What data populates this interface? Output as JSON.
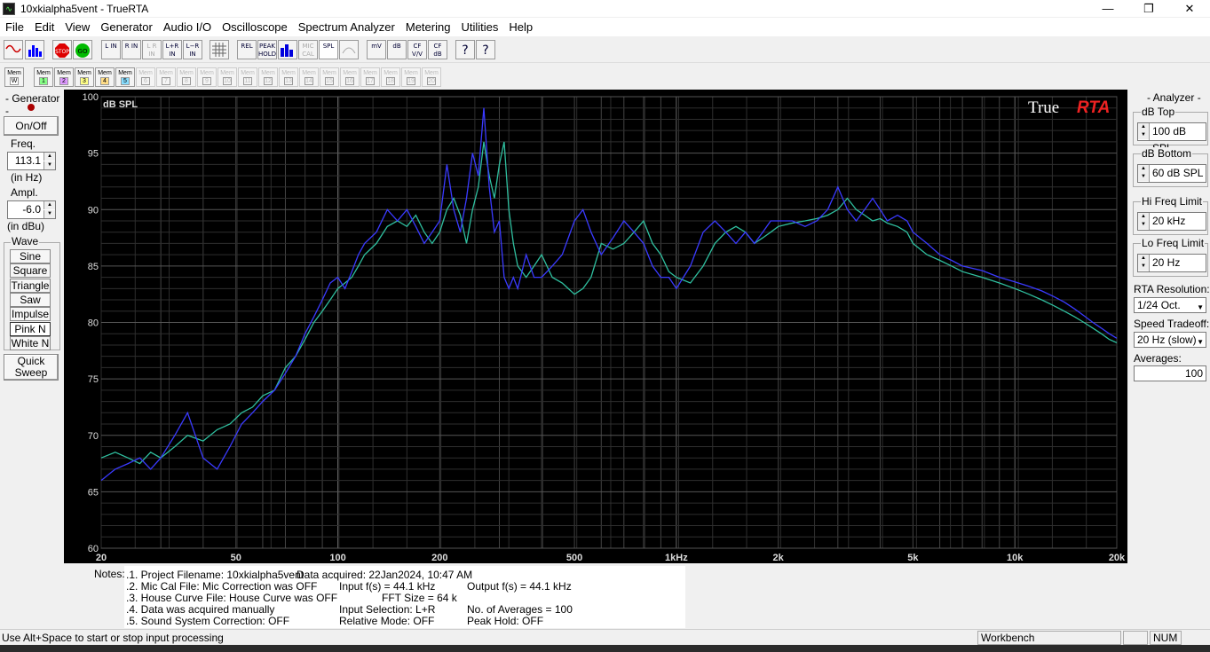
{
  "window": {
    "title": "10xkialpha5vent - TrueRTA",
    "minimize": "—",
    "maximize": "❐",
    "close": "✕"
  },
  "menu": [
    "File",
    "Edit",
    "View",
    "Generator",
    "Audio I/O",
    "Oscilloscope",
    "Spectrum Analyzer",
    "Metering",
    "Utilities",
    "Help"
  ],
  "toolbar": [
    "L IN",
    "R IN",
    "L R IN",
    "L+R IN",
    "L−R IN",
    "REL",
    "PEAK HOLD",
    "MIC CAL",
    "SPL",
    "mV",
    "dB",
    "CF V/V",
    "CF dB",
    "?",
    "?"
  ],
  "memories": {
    "prefix": "Mem",
    "labels": [
      "W",
      "1",
      "2",
      "3",
      "4",
      "5",
      "6",
      "7",
      "8",
      "9",
      "10",
      "11",
      "12",
      "13",
      "14",
      "15",
      "16",
      "17",
      "18",
      "19",
      "20"
    ]
  },
  "generator": {
    "title": "- Generator -",
    "onoff": "On/Off",
    "freq_title": "Freq.",
    "freq_value": "113.1",
    "freq_unit": "(in Hz)",
    "ampl_title": "Ampl.",
    "ampl_value": "-6.0",
    "ampl_unit": "(in dBu)",
    "wave_title": "Wave",
    "waves": [
      "Sine",
      "Square",
      "Triangle",
      "Saw",
      "Impulse",
      "Pink N",
      "White N"
    ],
    "quick_sweep": "Quick Sweep"
  },
  "analyzer": {
    "title": "- Analyzer -",
    "db_top_label": "dB Top",
    "db_top": "100 dB SPL",
    "db_bottom_label": "dB Bottom",
    "db_bottom": "60 dB SPL",
    "hi_label": "Hi Freq Limit",
    "hi": "20 kHz",
    "lo_label": "Lo Freq Limit",
    "lo": "20 Hz",
    "res_label": "RTA Resolution:",
    "res": "1/24 Oct.",
    "speed_label": "Speed Tradeoff:",
    "speed": "20 Hz (slow)",
    "avg_label": "Averages:",
    "avg": "100"
  },
  "chart_data": {
    "type": "line",
    "ylabel": "dB SPL",
    "brand_a": "True",
    "brand_b": "RTA",
    "ylim": [
      60,
      100
    ],
    "xlim": [
      20,
      20000
    ],
    "x_scale": "log",
    "yticks": [
      60,
      65,
      70,
      75,
      80,
      85,
      90,
      95,
      100
    ],
    "xtick_labels": [
      {
        "v": 20,
        "t": "20"
      },
      {
        "v": 50,
        "t": "50"
      },
      {
        "v": 100,
        "t": "100"
      },
      {
        "v": 200,
        "t": "200"
      },
      {
        "v": 500,
        "t": "500"
      },
      {
        "v": 1000,
        "t": "1kHz"
      },
      {
        "v": 2000,
        "t": "2k"
      },
      {
        "v": 5000,
        "t": "5k"
      },
      {
        "v": 10000,
        "t": "10k"
      },
      {
        "v": 20000,
        "t": "20k"
      }
    ],
    "grid": true,
    "colors": {
      "bg": "#000000",
      "grid": "#3a3a3a",
      "blue": "#3a3aff",
      "cyan": "#2fbf9f"
    },
    "series": [
      {
        "color": "#2fbf9f",
        "x": [
          20,
          22,
          24,
          26,
          28,
          30,
          33,
          36,
          40,
          44,
          48,
          52,
          56,
          60,
          65,
          70,
          75,
          80,
          85,
          90,
          95,
          100,
          105,
          110,
          115,
          120,
          130,
          140,
          150,
          160,
          170,
          180,
          190,
          200,
          210,
          220,
          230,
          240,
          250,
          260,
          270,
          280,
          290,
          300,
          310,
          320,
          330,
          340,
          360,
          380,
          400,
          430,
          460,
          500,
          530,
          560,
          600,
          650,
          700,
          750,
          800,
          850,
          900,
          950,
          1000,
          1100,
          1200,
          1300,
          1400,
          1500,
          1600,
          1700,
          1800,
          1900,
          2000,
          2200,
          2400,
          2600,
          2800,
          3000,
          3200,
          3400,
          3600,
          3800,
          4000,
          4200,
          4500,
          4800,
          5000,
          5500,
          6000,
          6500,
          7000,
          8000,
          9000,
          10000,
          11000,
          12000,
          13000,
          14000,
          15000,
          16000,
          17000,
          18000,
          19000,
          20000
        ],
        "y": [
          68,
          68.5,
          68,
          67.5,
          68.5,
          68,
          69,
          70,
          69.5,
          70.5,
          71,
          72,
          72.5,
          73.5,
          74,
          76,
          77,
          78.5,
          80,
          81,
          82,
          83,
          83.5,
          84,
          85,
          86,
          87,
          88.5,
          89,
          88.5,
          89.5,
          88,
          87,
          88,
          90,
          91,
          89.5,
          87,
          90,
          92,
          96,
          93,
          91,
          94,
          96,
          90,
          87,
          85,
          84,
          85,
          86,
          84,
          83.5,
          82.5,
          83,
          84,
          87,
          86.5,
          87,
          88,
          89,
          87,
          86,
          84.5,
          84,
          83.5,
          85,
          87,
          88,
          88.5,
          88,
          87,
          87.5,
          88,
          88.5,
          88.8,
          89,
          89.2,
          89.5,
          90,
          91,
          90,
          89.5,
          89,
          89.2,
          88.8,
          88.5,
          88,
          87,
          86,
          85.5,
          85,
          84.5,
          84,
          83.5,
          83,
          82.5,
          82,
          81.5,
          81,
          80.5,
          80,
          79.5,
          79,
          78.5,
          78.2
        ]
      },
      {
        "color": "#3a3aff",
        "x": [
          20,
          22,
          24,
          26,
          28,
          30,
          33,
          36,
          40,
          44,
          48,
          52,
          56,
          60,
          65,
          70,
          75,
          80,
          85,
          90,
          95,
          100,
          105,
          110,
          115,
          120,
          130,
          140,
          150,
          160,
          170,
          180,
          190,
          200,
          210,
          220,
          230,
          240,
          250,
          260,
          270,
          280,
          290,
          300,
          310,
          320,
          330,
          340,
          360,
          380,
          400,
          430,
          460,
          500,
          530,
          560,
          600,
          650,
          700,
          750,
          800,
          850,
          900,
          950,
          1000,
          1100,
          1200,
          1300,
          1400,
          1500,
          1600,
          1700,
          1800,
          1900,
          2000,
          2200,
          2400,
          2600,
          2800,
          3000,
          3200,
          3400,
          3600,
          3800,
          4000,
          4200,
          4500,
          4800,
          5000,
          5500,
          6000,
          6500,
          7000,
          8000,
          9000,
          10000,
          11000,
          12000,
          13000,
          14000,
          15000,
          16000,
          17000,
          18000,
          19000,
          20000
        ],
        "y": [
          66,
          67,
          67.5,
          68,
          67,
          68,
          70,
          72,
          68,
          67,
          69,
          71,
          72,
          73,
          74,
          75.5,
          77,
          79,
          80.5,
          82,
          83.5,
          84,
          83,
          84.5,
          86,
          87,
          88,
          90,
          89,
          90,
          88.5,
          87,
          88,
          89,
          94,
          90,
          88,
          91,
          95,
          93,
          99,
          92,
          88,
          89,
          84,
          83,
          84,
          83,
          86,
          84,
          84,
          85,
          86,
          89,
          90,
          88,
          86,
          87.5,
          89,
          88,
          87,
          85,
          84,
          84,
          83,
          85,
          88,
          89,
          88,
          87,
          88,
          87,
          88,
          89,
          89,
          89,
          88.5,
          89,
          90,
          92,
          90,
          89,
          90,
          91,
          90,
          89,
          89.5,
          89,
          88,
          87,
          86,
          85.5,
          85,
          84.6,
          84,
          83.6,
          83.2,
          82.8,
          82.3,
          81.8,
          81.2,
          80.6,
          80,
          79.5,
          79,
          78.6
        ]
      }
    ]
  },
  "notes": {
    "label": "Notes:",
    "lines": [
      {
        "left": ".1. Project Filename: 10xkialpha5vent",
        "mid": "Data acquired: 22Jan2024, 10:47 AM",
        "right": ""
      },
      {
        "left": ".2. Mic Cal File: Mic Correction was OFF",
        "mid": "Input f(s) = 44.1 kHz",
        "right": "Output f(s) = 44.1 kHz"
      },
      {
        "left": ".3. House Curve File: House Curve was OFF",
        "mid": "FFT Size = 64 k",
        "right": ""
      },
      {
        "left": ".4. Data was acquired manually",
        "mid": "Input Selection: L+R",
        "right": "No. of Averages = 100"
      },
      {
        "left": ".5. Sound System Correction: OFF",
        "mid": "Relative Mode:  OFF",
        "right": "Peak Hold: OFF"
      }
    ]
  },
  "status": {
    "hint": "Use Alt+Space to start or stop input processing",
    "workbench": "Workbench",
    "num": "NUM"
  }
}
